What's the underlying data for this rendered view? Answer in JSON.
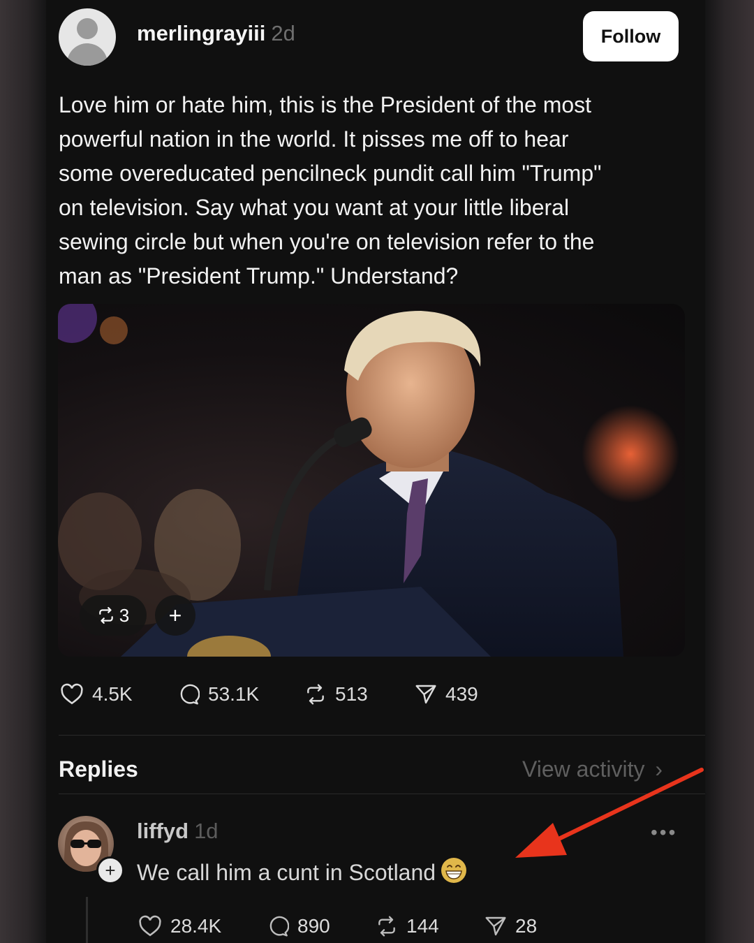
{
  "post": {
    "username": "merlingrayiii",
    "time": "2d",
    "follow_label": "Follow",
    "text": "Love him or hate him, this is the President of the most\npowerful nation in the world. It pisses me off to hear\nsome overeducated pencilneck pundit call him \"Trump\"\non television.  Say what you want at your little liberal\nsewing circle but when you're on television refer to the\nman as \"President Trump.\" Understand?",
    "media_repost_count": "3",
    "media_add_label": "+",
    "stats": {
      "likes": "4.5K",
      "replies": "53.1K",
      "reposts": "513",
      "shares": "439"
    }
  },
  "replies_section": {
    "label": "Replies",
    "view_activity": "View activity"
  },
  "reply": {
    "username": "liffyd",
    "time": "1d",
    "text": "We call him a cunt in Scotland",
    "more_label": "•••",
    "stats": {
      "likes": "28.4K",
      "replies": "890",
      "reposts": "144",
      "shares": "28"
    }
  },
  "icons": [
    "heart-icon",
    "comment-icon",
    "repost-icon",
    "share-icon",
    "chevron-right-icon",
    "grin-emoji",
    "red-arrow"
  ],
  "colors": {
    "accent_arrow": "#e8341c",
    "background": "#101010"
  }
}
